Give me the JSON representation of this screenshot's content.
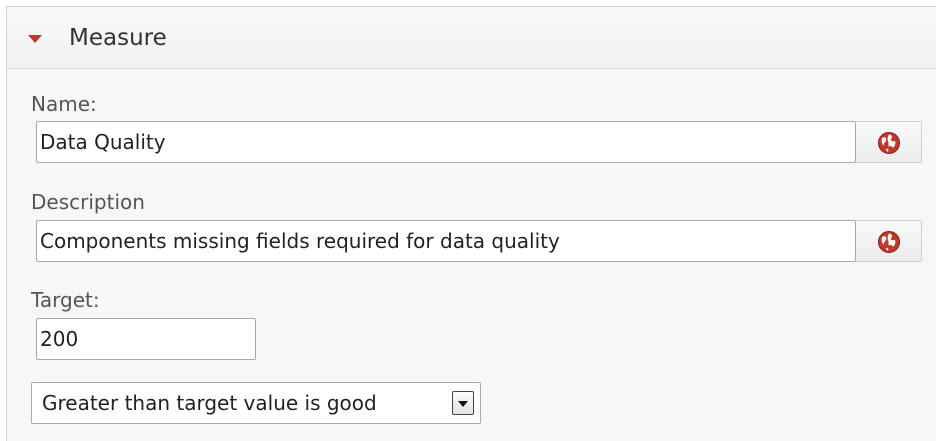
{
  "panel": {
    "title": "Measure",
    "toggle_icon": "caret-down-icon",
    "accent_color": "#c0392b"
  },
  "form": {
    "name": {
      "label": "Name:",
      "value": "Data Quality",
      "translate_icon": "globe-icon"
    },
    "description": {
      "label": "Description",
      "value": "Components missing fields required for data quality",
      "translate_icon": "globe-icon"
    },
    "target": {
      "label": "Target:",
      "value": "200"
    },
    "comparison": {
      "selected": "Greater than target value is good",
      "icon": "dropdown-arrow-icon"
    }
  }
}
